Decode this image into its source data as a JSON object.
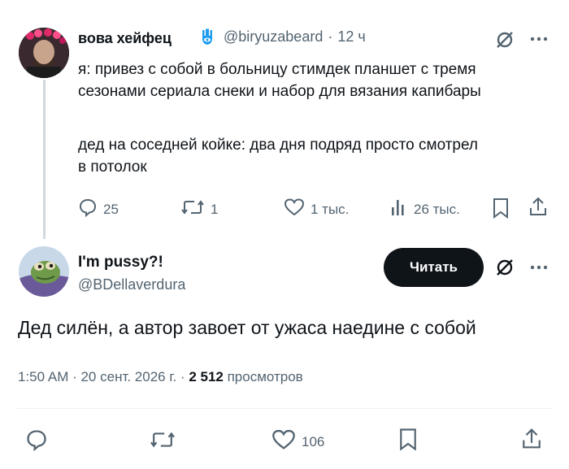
{
  "original_tweet": {
    "author_name": "вова хейфец",
    "handle": "@biryuzabeard",
    "separator": "·",
    "time": "12 ч",
    "text_lines": [
      "я: привез с собой в больницу стимдек планшет с тремя",
      "сезонами сериала снеки и набор для вязания капибары",
      "",
      "дед на соседней койке: два дня подряд просто смотрел",
      "в потолок"
    ],
    "replies": "25",
    "reposts": "1",
    "likes": "1 тыс.",
    "views": "26 тыс."
  },
  "reply_tweet": {
    "author_name": "I'm pussy?!",
    "handle": "@BDellaverdura",
    "follow_button": "Читать",
    "text": "Дед силён, а автор завоет от ужаса наедине с собой",
    "time": "1:50 AM · 20 сент. 2026 г. · ",
    "views_count": "2 512",
    "views_label": " просмотров",
    "likes": "106"
  },
  "colors": {
    "text": "#0f1419",
    "secondary": "#536471",
    "badge_blue": "#1d9bf0",
    "button_bg": "#0f1419"
  }
}
